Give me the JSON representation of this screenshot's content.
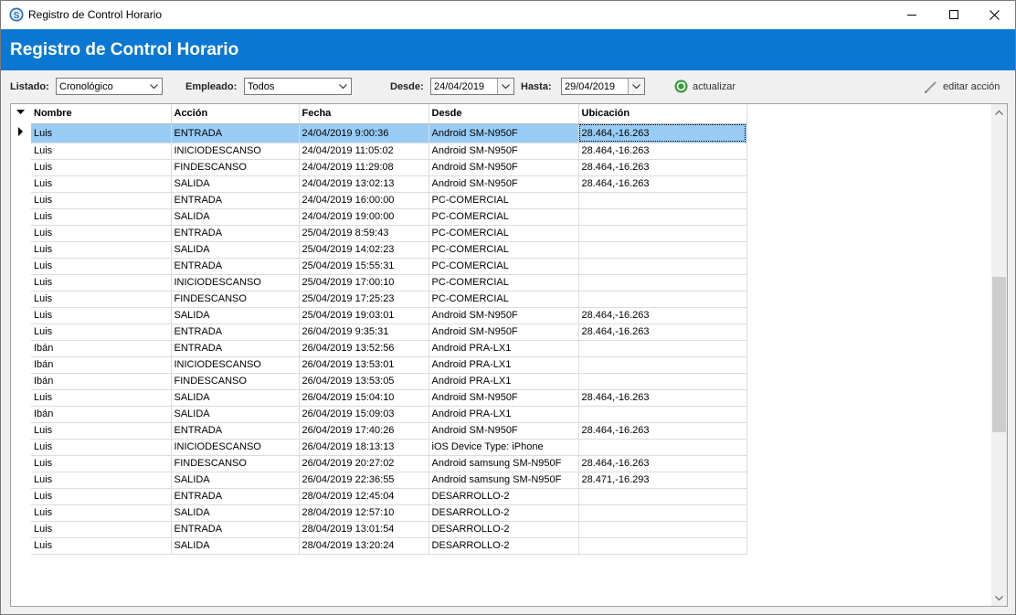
{
  "window": {
    "title": "Registro de Control Horario"
  },
  "banner": {
    "title": "Registro de Control Horario",
    "color": "#0a78d2"
  },
  "toolbar": {
    "listado_label": "Listado:",
    "listado_value": "Cronológico",
    "empleado_label": "Empleado:",
    "empleado_value": "Todos",
    "desde_label": "Desde:",
    "desde_value": "24/04/2019",
    "hasta_label": "Hasta:",
    "hasta_value": "29/04/2019",
    "refresh_label": "actualizar",
    "edit_label": "editar acción"
  },
  "table": {
    "columns": [
      "Nombre",
      "Acción",
      "Fecha",
      "Desde",
      "Ubicación"
    ],
    "selected_row": 0,
    "rows": [
      [
        "Luis",
        "ENTRADA",
        "24/04/2019 9:00:36",
        "Android SM-N950F",
        "28.464,-16.263"
      ],
      [
        "Luis",
        "INICIODESCANSO",
        "24/04/2019 11:05:02",
        "Android SM-N950F",
        "28.464,-16.263"
      ],
      [
        "Luis",
        "FINDESCANSO",
        "24/04/2019 11:29:08",
        "Android SM-N950F",
        "28.464,-16.263"
      ],
      [
        "Luis",
        "SALIDA",
        "24/04/2019 13:02:13",
        "Android SM-N950F",
        "28.464,-16.263"
      ],
      [
        "Luis",
        "ENTRADA",
        "24/04/2019 16:00:00",
        "PC-COMERCIAL",
        ""
      ],
      [
        "Luis",
        "SALIDA",
        "24/04/2019 19:00:00",
        "PC-COMERCIAL",
        ""
      ],
      [
        "Luis",
        "ENTRADA",
        "25/04/2019 8:59:43",
        "PC-COMERCIAL",
        ""
      ],
      [
        "Luis",
        "SALIDA",
        "25/04/2019 14:02:23",
        "PC-COMERCIAL",
        ""
      ],
      [
        "Luis",
        "ENTRADA",
        "25/04/2019 15:55:31",
        "PC-COMERCIAL",
        ""
      ],
      [
        "Luis",
        "INICIODESCANSO",
        "25/04/2019 17:00:10",
        "PC-COMERCIAL",
        ""
      ],
      [
        "Luis",
        "FINDESCANSO",
        "25/04/2019 17:25:23",
        "PC-COMERCIAL",
        ""
      ],
      [
        "Luis",
        "SALIDA",
        "25/04/2019 19:03:01",
        "Android SM-N950F",
        "28.464,-16.263"
      ],
      [
        "Luis",
        "ENTRADA",
        "26/04/2019 9:35:31",
        "Android SM-N950F",
        "28.464,-16.263"
      ],
      [
        "Ibán",
        "ENTRADA",
        "26/04/2019 13:52:56",
        "Android PRA-LX1",
        ""
      ],
      [
        "Ibán",
        "INICIODESCANSO",
        "26/04/2019 13:53:01",
        "Android PRA-LX1",
        ""
      ],
      [
        "Ibán",
        "FINDESCANSO",
        "26/04/2019 13:53:05",
        "Android PRA-LX1",
        ""
      ],
      [
        "Luis",
        "SALIDA",
        "26/04/2019 15:04:10",
        "Android SM-N950F",
        "28.464,-16.263"
      ],
      [
        "Ibán",
        "SALIDA",
        "26/04/2019 15:09:03",
        "Android PRA-LX1",
        ""
      ],
      [
        "Luis",
        "ENTRADA",
        "26/04/2019 17:40:26",
        "Android SM-N950F",
        "28.464,-16.263"
      ],
      [
        "Luis",
        "INICIODESCANSO",
        "26/04/2019 18:13:13",
        "iOS Device Type: iPhone",
        ""
      ],
      [
        "Luis",
        "FINDESCANSO",
        "26/04/2019 20:27:02",
        "Android samsung SM-N950F",
        "28.464,-16.263"
      ],
      [
        "Luis",
        "SALIDA",
        "26/04/2019 22:36:55",
        "Android samsung SM-N950F",
        "28.471,-16.293"
      ],
      [
        "Luis",
        "ENTRADA",
        "28/04/2019 12:45:04",
        "DESARROLLO-2",
        ""
      ],
      [
        "Luis",
        "SALIDA",
        "28/04/2019 12:57:10",
        "DESARROLLO-2",
        ""
      ],
      [
        "Luis",
        "ENTRADA",
        "28/04/2019 13:01:54",
        "DESARROLLO-2",
        ""
      ],
      [
        "Luis",
        "SALIDA",
        "28/04/2019 13:20:24",
        "DESARROLLO-2",
        ""
      ]
    ]
  }
}
